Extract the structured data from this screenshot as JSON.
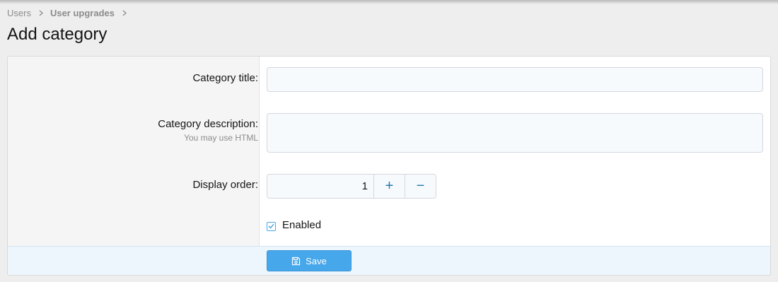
{
  "breadcrumb": {
    "items": [
      {
        "label": "Users"
      },
      {
        "label": "User upgrades"
      }
    ]
  },
  "page": {
    "title": "Add category"
  },
  "form": {
    "category_title": {
      "label": "Category title:",
      "value": ""
    },
    "category_description": {
      "label": "Category description:",
      "hint": "You may use HTML",
      "value": ""
    },
    "display_order": {
      "label": "Display order:",
      "value": "1",
      "increment_symbol": "+",
      "decrement_symbol": "−"
    },
    "enabled": {
      "label": "Enabled",
      "checked": true
    },
    "save_label": "Save"
  },
  "colors": {
    "accent": "#47a7eb",
    "submit_row_bg": "#edf6fd",
    "label_col_bg": "#f5f5f5",
    "page_bg": "#eeeeee"
  },
  "icons": {
    "breadcrumb_separator": "chevron-right-icon",
    "save": "save-icon",
    "checkbox": "check-icon"
  }
}
